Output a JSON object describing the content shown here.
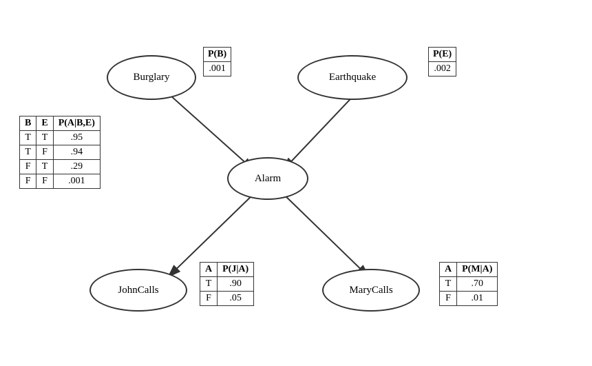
{
  "nodes": {
    "burglary": {
      "label": "Burglary"
    },
    "earthquake": {
      "label": "Earthquake"
    },
    "alarm": {
      "label": "Alarm"
    },
    "johncalls": {
      "label": "JohnCalls"
    },
    "marycalls": {
      "label": "MaryCalls"
    }
  },
  "tables": {
    "pb": {
      "header": "P(B)",
      "value": ".001"
    },
    "pe": {
      "header": "P(E)",
      "value": ".002"
    },
    "alarm_cpt": {
      "headers": [
        "B",
        "E",
        "P(A|B,E)"
      ],
      "rows": [
        [
          "T",
          "T",
          ".95"
        ],
        [
          "T",
          "F",
          ".94"
        ],
        [
          "F",
          "T",
          ".29"
        ],
        [
          "F",
          "F",
          ".001"
        ]
      ]
    },
    "john_cpt": {
      "headers": [
        "A",
        "P(J|A)"
      ],
      "rows": [
        [
          "T",
          ".90"
        ],
        [
          "F",
          ".05"
        ]
      ]
    },
    "mary_cpt": {
      "headers": [
        "A",
        "P(M|A)"
      ],
      "rows": [
        [
          "T",
          ".70"
        ],
        [
          "F",
          ".01"
        ]
      ]
    }
  }
}
